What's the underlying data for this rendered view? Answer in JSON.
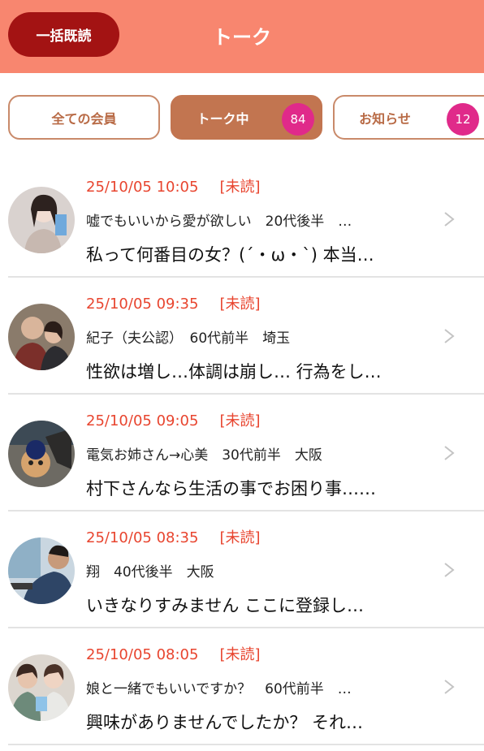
{
  "header": {
    "title": "トーク",
    "mark_all_read_label": "一括既読"
  },
  "tabs": [
    {
      "label": "全ての会員",
      "active": false
    },
    {
      "label": "トーク中",
      "badge": "84",
      "active": true
    },
    {
      "label": "お知らせ",
      "badge": "12",
      "active": false
    }
  ],
  "conversations": [
    {
      "timestamp": "25/10/05 10:05",
      "status": "[未読]",
      "profile": "嘘でもいいから愛が欲しい　20代後半　…",
      "message": "私って何番目の女？(´・ω・`) 本当…"
    },
    {
      "timestamp": "25/10/05 09:35",
      "status": "[未読]",
      "profile": "紀子（夫公認）　60代前半　埼玉",
      "message": "性欲は増し…体調は崩し… 行為をし…"
    },
    {
      "timestamp": "25/10/05 09:05",
      "status": "[未読]",
      "profile": "電気お姉さん→心美　30代前半　大阪",
      "message": "村下さんなら生活の事でお困り事……"
    },
    {
      "timestamp": "25/10/05 08:35",
      "status": "[未読]",
      "profile": "翔　40代後半　大阪",
      "message": "いきなりすみません ここに登録し…"
    },
    {
      "timestamp": "25/10/05 08:05",
      "status": "[未読]",
      "profile": "娘と一緒でもいいですか？　60代前半　…",
      "message": "興味がありませんでしたか？ それ…"
    }
  ],
  "colors": {
    "header_bg": "#f8866f",
    "mark_all_bg": "#a31313",
    "tab_active_bg": "#c27550",
    "badge_bg": "#e02a8a",
    "unread_text": "#e8452f"
  },
  "icons": {
    "row_chevron": "chevron-right-icon"
  }
}
